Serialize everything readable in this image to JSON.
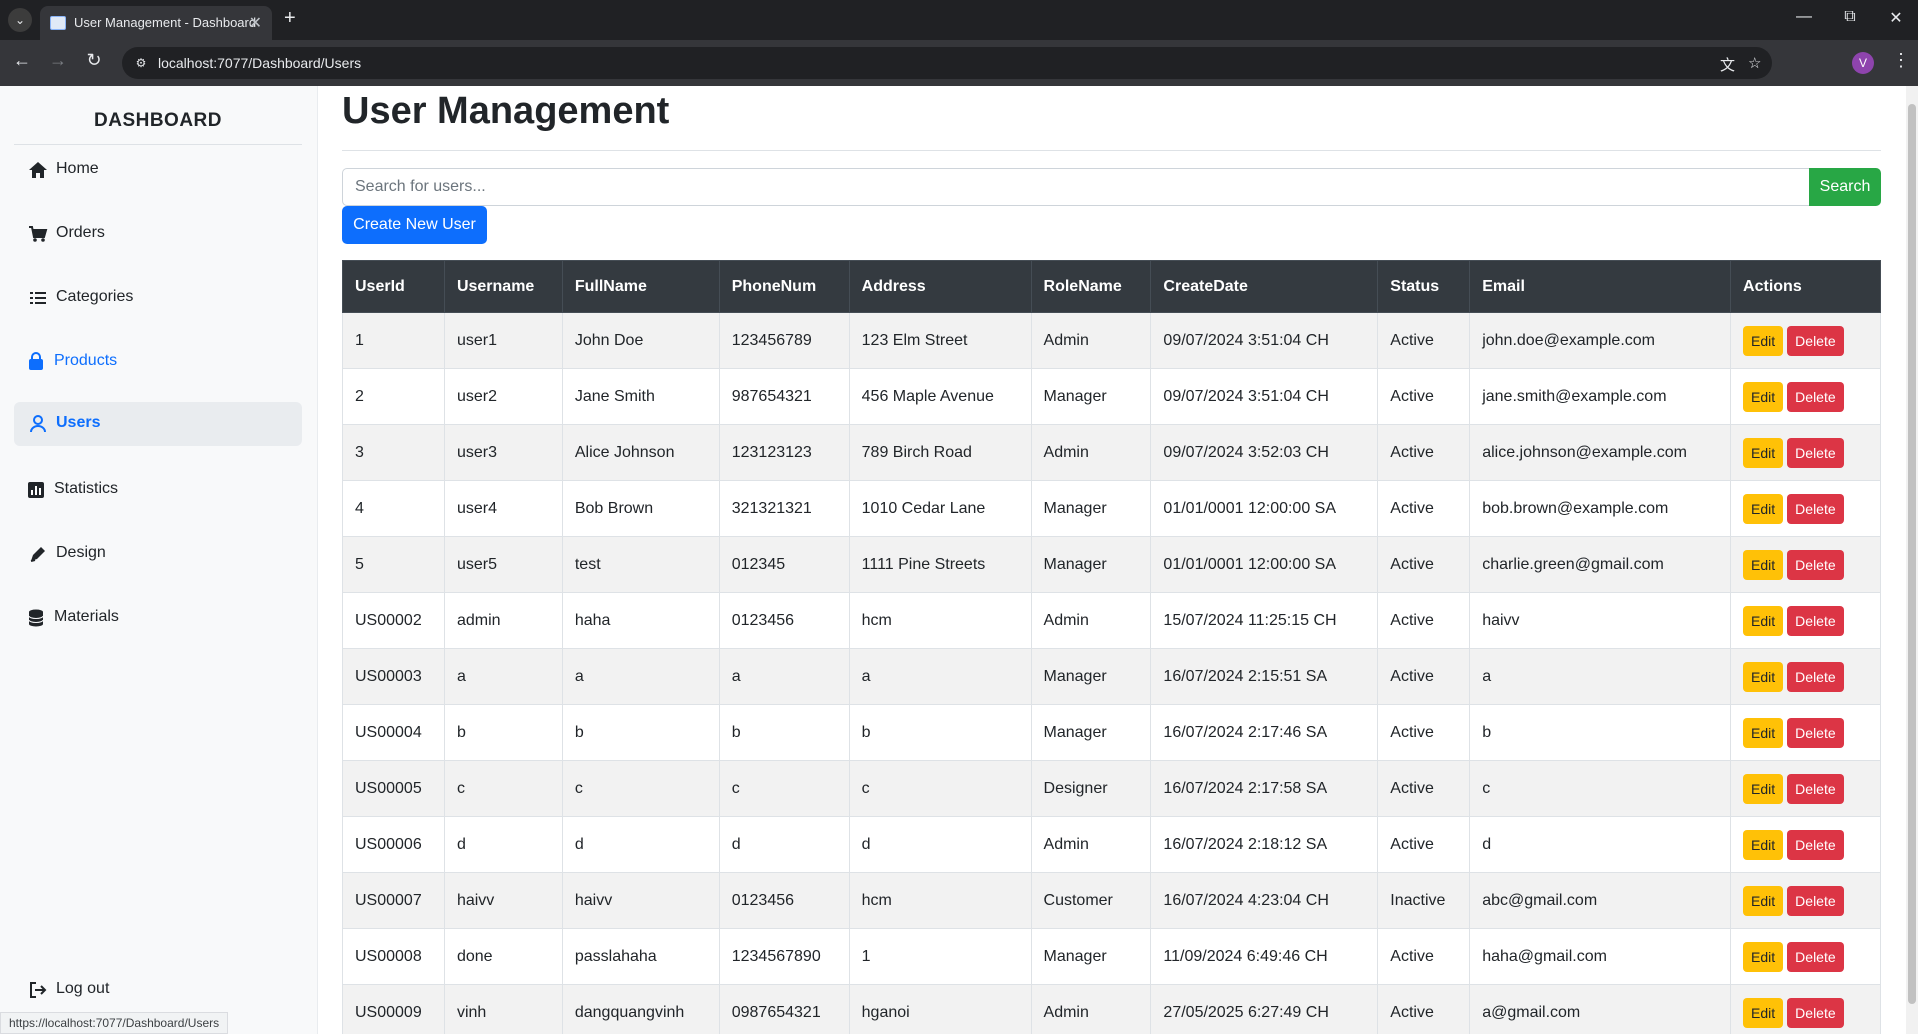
{
  "browser": {
    "tab_title": "User Management - Dashboard",
    "url": "localhost:7077/Dashboard/Users",
    "profile_initial": "V",
    "status_url": "https://localhost:7077/Dashboard/Users"
  },
  "sidebar": {
    "brand": "DASHBOARD",
    "items": [
      {
        "label": "Home",
        "icon": "home-icon"
      },
      {
        "label": "Orders",
        "icon": "cart-icon"
      },
      {
        "label": "Categories",
        "icon": "list-icon"
      },
      {
        "label": "Products",
        "icon": "bag-icon"
      },
      {
        "label": "Users",
        "icon": "user-icon"
      },
      {
        "label": "Statistics",
        "icon": "chart-icon"
      },
      {
        "label": "Design",
        "icon": "pen-icon"
      },
      {
        "label": "Materials",
        "icon": "database-icon"
      }
    ],
    "logout": "Log out"
  },
  "main": {
    "title": "User Management",
    "search_placeholder": "Search for users...",
    "search_button": "Search",
    "create_button": "Create New User",
    "columns": [
      "UserId",
      "Username",
      "FullName",
      "PhoneNum",
      "Address",
      "RoleName",
      "CreateDate",
      "Status",
      "Email",
      "Actions"
    ],
    "edit_label": "Edit",
    "delete_label": "Delete",
    "rows": [
      [
        "1",
        "user1",
        "John Doe",
        "123456789",
        "123 Elm Street",
        "Admin",
        "09/07/2024 3:51:04 CH",
        "Active",
        "john.doe@example.com"
      ],
      [
        "2",
        "user2",
        "Jane Smith",
        "987654321",
        "456 Maple Avenue",
        "Manager",
        "09/07/2024 3:51:04 CH",
        "Active",
        "jane.smith@example.com"
      ],
      [
        "3",
        "user3",
        "Alice Johnson",
        "123123123",
        "789 Birch Road",
        "Admin",
        "09/07/2024 3:52:03 CH",
        "Active",
        "alice.johnson@example.com"
      ],
      [
        "4",
        "user4",
        "Bob Brown",
        "321321321",
        "1010 Cedar Lane",
        "Manager",
        "01/01/0001 12:00:00 SA",
        "Active",
        "bob.brown@example.com"
      ],
      [
        "5",
        "user5",
        "test",
        "012345",
        "1111 Pine Streets",
        "Manager",
        "01/01/0001 12:00:00 SA",
        "Active",
        "charlie.green@gmail.com"
      ],
      [
        "US00002",
        "admin",
        "haha",
        "0123456",
        "hcm",
        "Admin",
        "15/07/2024 11:25:15 CH",
        "Active",
        "haivv"
      ],
      [
        "US00003",
        "a",
        "a",
        "a",
        "a",
        "Manager",
        "16/07/2024 2:15:51 SA",
        "Active",
        "a"
      ],
      [
        "US00004",
        "b",
        "b",
        "b",
        "b",
        "Manager",
        "16/07/2024 2:17:46 SA",
        "Active",
        "b"
      ],
      [
        "US00005",
        "c",
        "c",
        "c",
        "c",
        "Designer",
        "16/07/2024 2:17:58 SA",
        "Active",
        "c"
      ],
      [
        "US00006",
        "d",
        "d",
        "d",
        "d",
        "Admin",
        "16/07/2024 2:18:12 SA",
        "Active",
        "d"
      ],
      [
        "US00007",
        "haivv",
        "haivv",
        "0123456",
        "hcm",
        "Customer",
        "16/07/2024 4:23:04 CH",
        "Inactive",
        "abc@gmail.com"
      ],
      [
        "US00008",
        "done",
        "passlahaha",
        "1234567890",
        "1",
        "Manager",
        "11/09/2024 6:49:46 CH",
        "Active",
        "haha@gmail.com"
      ],
      [
        "US00009",
        "vinh",
        "dangquangvinh",
        "0987654321",
        "hganoi",
        "Admin",
        "27/05/2025 6:27:49 CH",
        "Active",
        "a@gmail.com"
      ]
    ]
  },
  "colors": {
    "primary": "#0d6efd",
    "success": "#28a745",
    "warning": "#ffc107",
    "danger": "#dc3545",
    "table_header": "#343a40"
  }
}
